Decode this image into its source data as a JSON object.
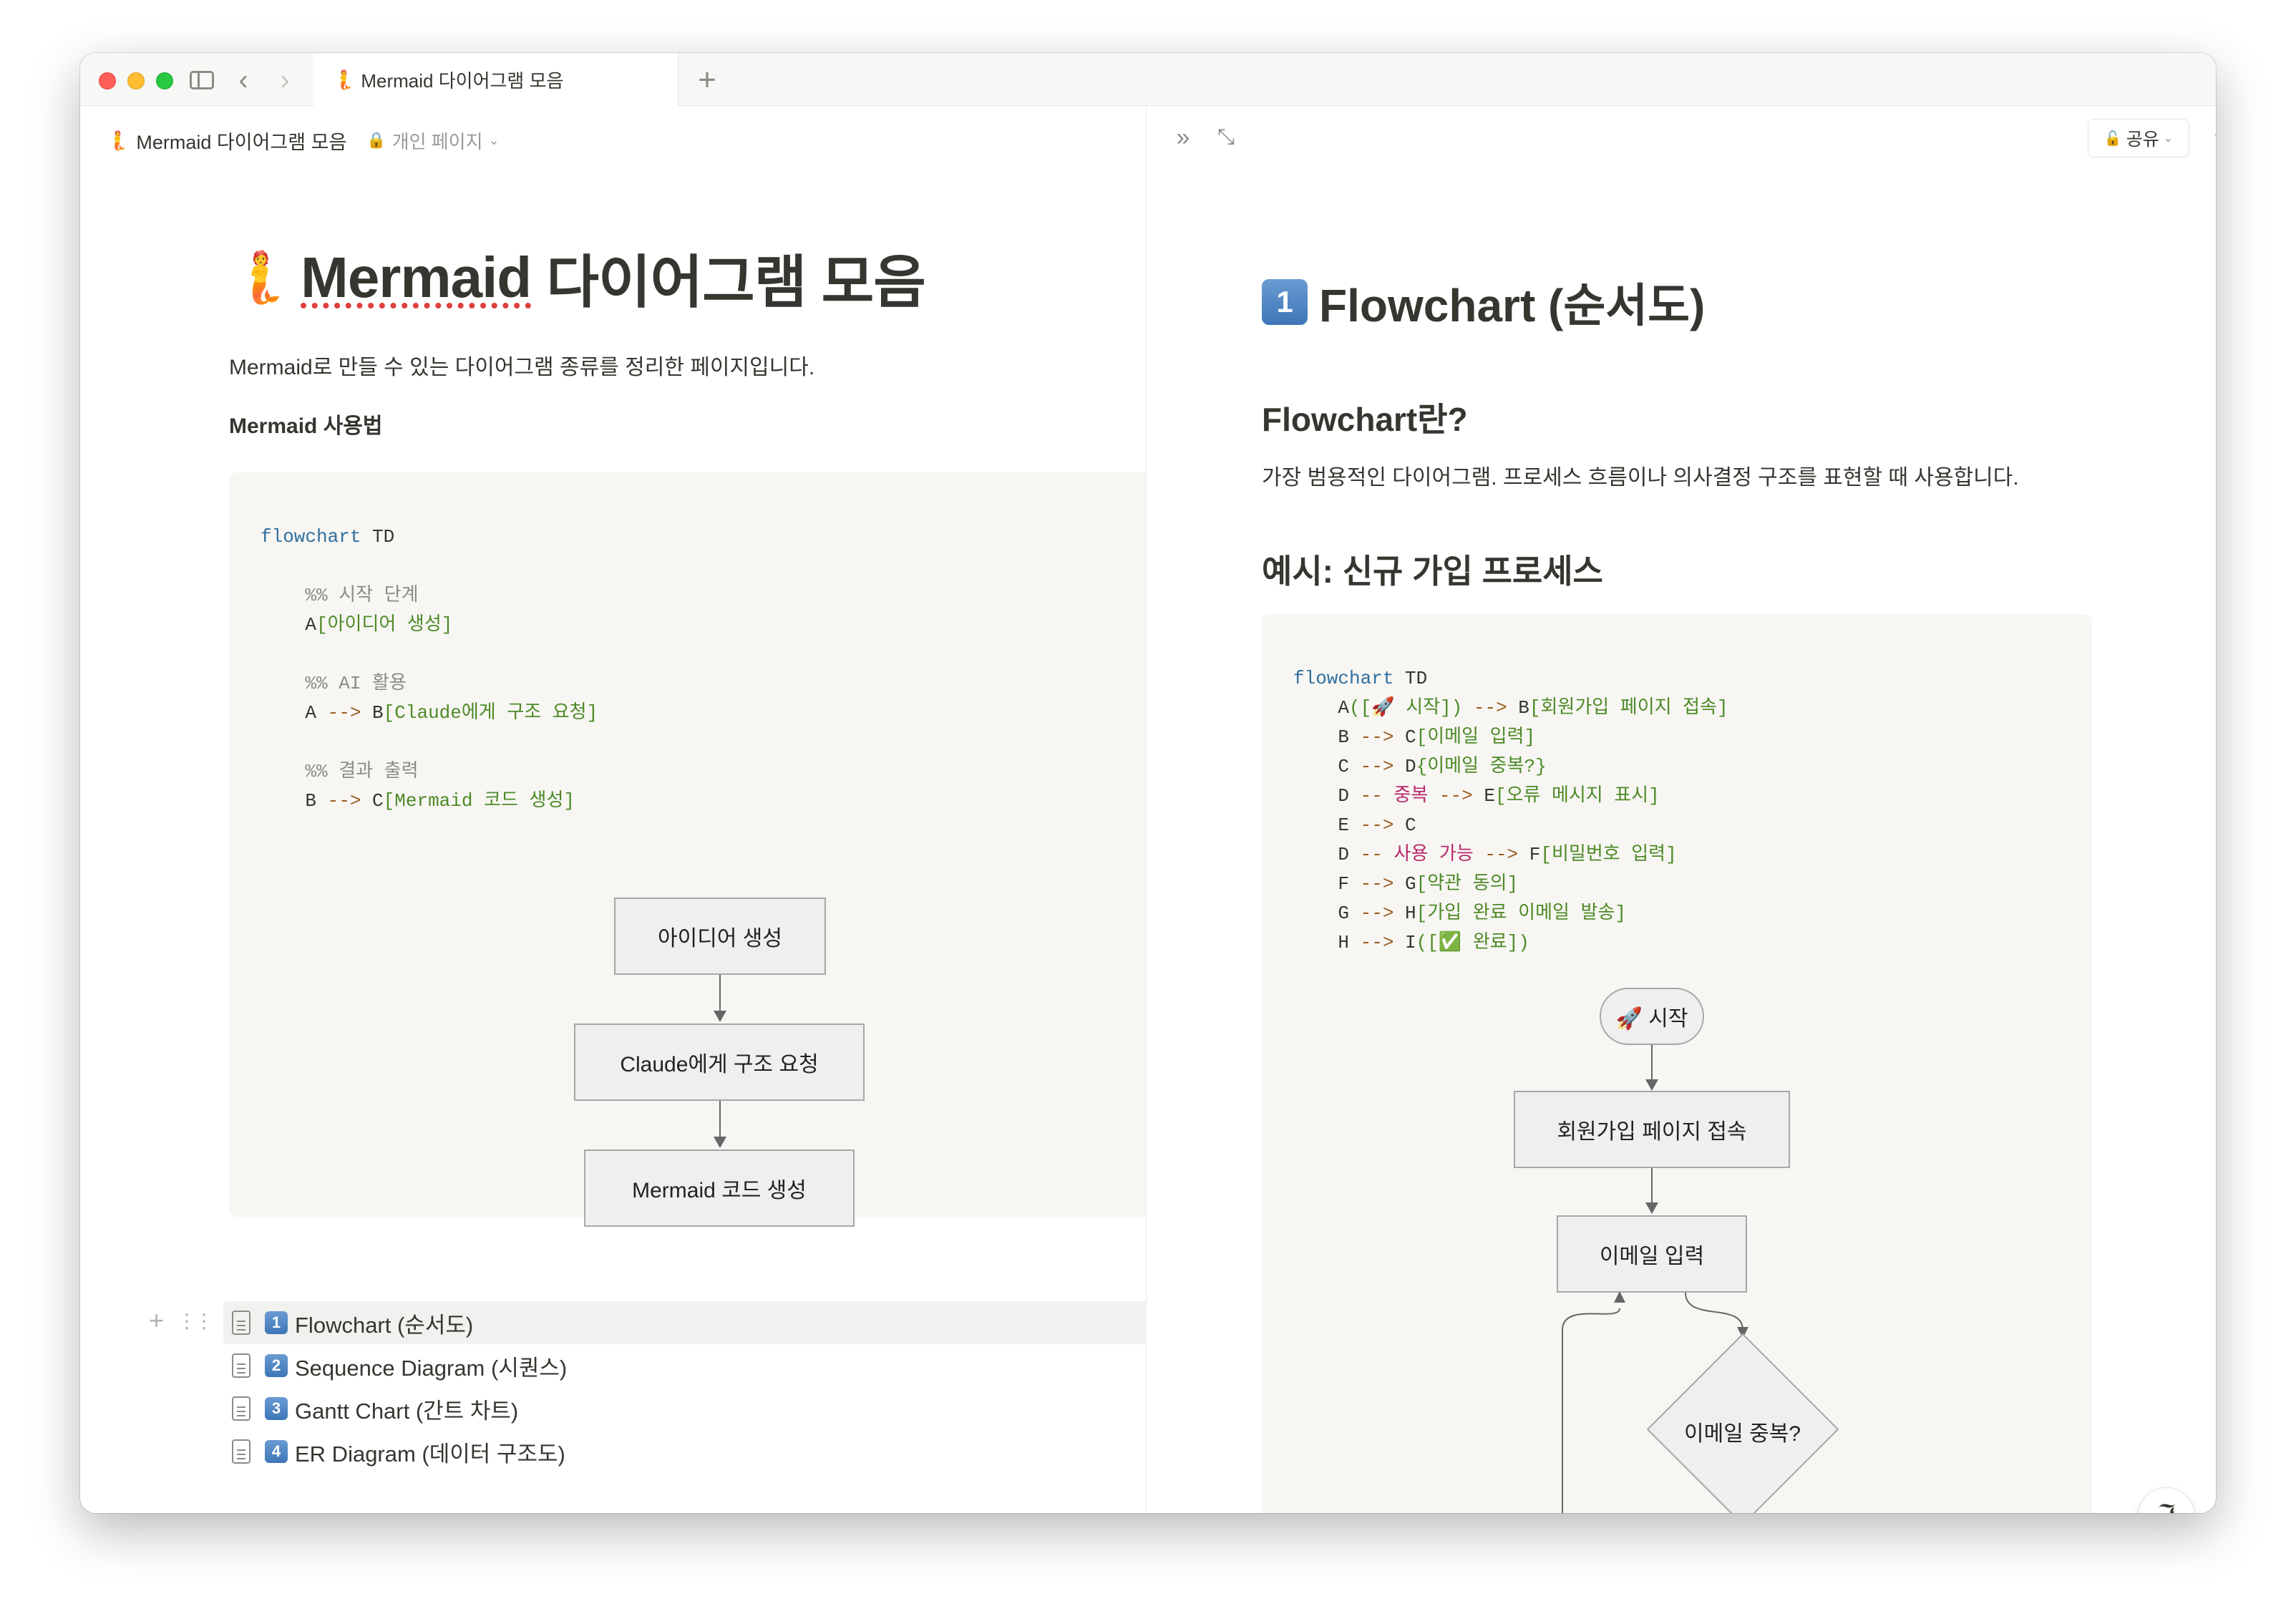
{
  "tab": {
    "emoji": "🧜",
    "title": "Mermaid 다이어그램 모음"
  },
  "breadcrumb": {
    "emoji": "🧜",
    "title": "Mermaid 다이어그램 모음",
    "privacy": "개인 페이지"
  },
  "page": {
    "emoji": "🧜",
    "title_word": "Mermaid",
    "title_rest": " 다이어그램 모음",
    "intro": "Mermaid로 만들 수 있는 다이어그램 종류를 정리한 페이지입니다.",
    "usage_heading": "Mermaid 사용법"
  },
  "left_code": {
    "l1_kw": "flowchart",
    "l1_dir": " TD",
    "c1": "%% 시작 단계",
    "l2_id": "A",
    "l2_str": "[아이디어 생성]",
    "c2": "%% AI 활용",
    "l3_a": "A",
    "l3_arrow": " --> ",
    "l3_b": "B",
    "l3_str": "[Claude에게 구조 요청]",
    "c3": "%% 결과 출력",
    "l4_a": "B",
    "l4_arrow": " --> ",
    "l4_b": "C",
    "l4_str": "[Mermaid 코드 생성]"
  },
  "left_diagram": {
    "n1": "아이디어 생성",
    "n2": "Claude에게 구조 요청",
    "n3": "Mermaid 코드 생성"
  },
  "page_links": [
    {
      "num": "1",
      "label": "Flowchart (순서도)"
    },
    {
      "num": "2",
      "label": "Sequence Diagram (시퀀스)"
    },
    {
      "num": "3",
      "label": "Gantt Chart (간트 차트)"
    },
    {
      "num": "4",
      "label": "ER Diagram (데이터 구조도)"
    }
  ],
  "right": {
    "share_label": "공유",
    "title_num": "1",
    "title": "Flowchart (순서도)",
    "h2": "Flowchart란?",
    "desc": "가장 범용적인 다이어그램. 프로세스 흐름이나 의사결정 구조를 표현할 때 사용합니다.",
    "h3": "예시: 신규 가입 프로세스"
  },
  "right_code": {
    "l0_kw": "flowchart",
    "l0_dir": " TD",
    "l1_a": "A",
    "l1_s": "([🚀 시작])",
    "l1_arr": " --> ",
    "l1_b": "B",
    "l1_t": "[회원가입 페이지 접속]",
    "l2_a": "B",
    "l2_arr": " --> ",
    "l2_b": "C",
    "l2_t": "[이메일 입력]",
    "l3_a": "C",
    "l3_arr": " --> ",
    "l3_b": "D",
    "l3_t": "{이메일 중복?}",
    "l4_a": "D",
    "l4_arr1": " -- ",
    "l4_lbl": "중복",
    "l4_arr2": " --> ",
    "l4_b": "E",
    "l4_t": "[오류 메시지 표시]",
    "l5_a": "E",
    "l5_arr": " --> ",
    "l5_b": "C",
    "l6_a": "D",
    "l6_arr1": " -- ",
    "l6_lbl": "사용 가능",
    "l6_arr2": " --> ",
    "l6_b": "F",
    "l6_t": "[비밀번호 입력]",
    "l7_a": "F",
    "l7_arr": " --> ",
    "l7_b": "G",
    "l7_t": "[약관 동의]",
    "l8_a": "G",
    "l8_arr": " --> ",
    "l8_b": "H",
    "l8_t": "[가입 완료 이메일 발송]",
    "l9_a": "H",
    "l9_arr": " --> ",
    "l9_b": "I",
    "l9_t": "([✅ 완료])"
  },
  "right_diagram": {
    "start": "🚀 시작",
    "n1": "회원가입 페이지 접속",
    "n2": "이메일 입력",
    "n3": "이메일 중복?"
  }
}
